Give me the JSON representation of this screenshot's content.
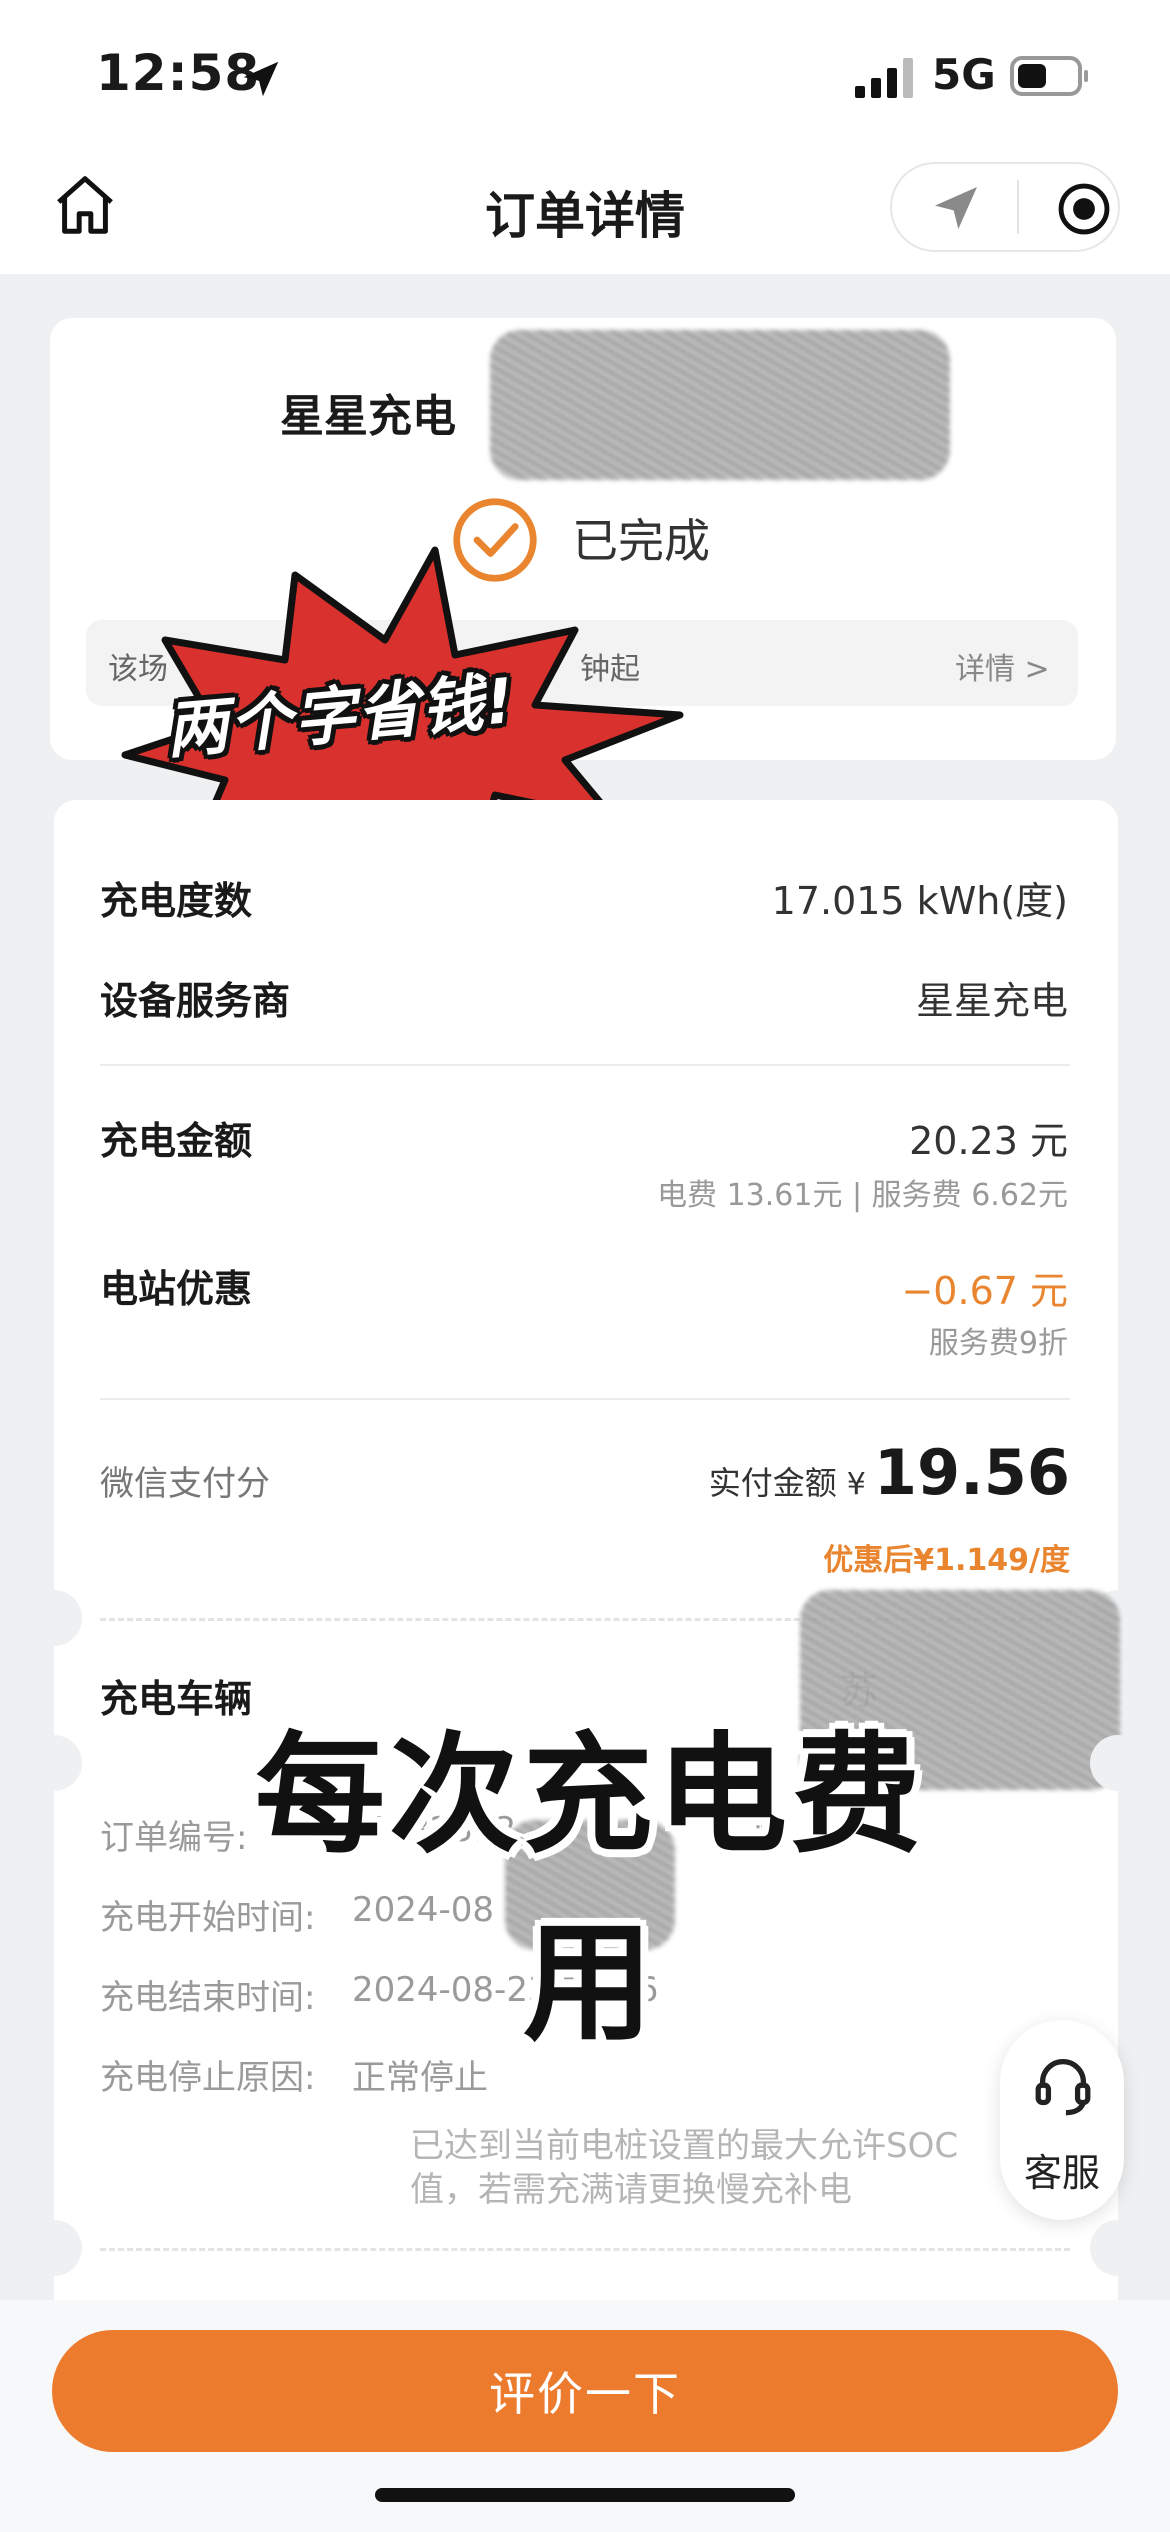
{
  "status_bar": {
    "time": "12:58",
    "network": "5G",
    "icons": [
      "location-arrow-icon",
      "signal-icon",
      "battery-icon"
    ]
  },
  "nav": {
    "title": "订单详情",
    "home_icon": "home-icon",
    "capsule_left_icon": "location-icon",
    "capsule_right_icon": "record-icon"
  },
  "order": {
    "station_name": "星星充电",
    "status": "已完成",
    "info_prefix": "该场",
    "info_suffix": "钟起",
    "info_link": "详情 >"
  },
  "overlay": {
    "burst_text": "两个字省钱!",
    "caption": "每次充电费用"
  },
  "details": {
    "energy_label": "充电度数",
    "energy_value": "17.015 kWh(度)",
    "provider_label": "设备服务商",
    "provider_value": "星星充电",
    "amount_label": "充电金额",
    "amount_value": "20.23 元",
    "amount_breakdown": "电费 13.61元 | 服务费 6.62元",
    "discount_label": "电站优惠",
    "discount_value": "−0.67 元",
    "discount_note": "服务费9折",
    "pay_method": "微信支付分",
    "pay_label": "实付金额",
    "pay_currency": "¥",
    "pay_amount": "19.56",
    "pay_unit_price": "优惠后¥1.149/度"
  },
  "vehicle": {
    "label": "充电车辆",
    "plate_prefix": "苏"
  },
  "meta": {
    "order_no_label": "订单编号:",
    "order_no_value": "2024082312",
    "start_label": "充电开始时间:",
    "start_value": "2024-08",
    "end_label": "充电结束时间:",
    "end_value": "2024-08-23 12:46",
    "stop_label": "充电停止原因:",
    "stop_value": "正常停止",
    "stop_note_line1": "已达到当前电桩设置的最大允许SOC",
    "stop_note_line2": "值，若需充满请更换慢充补电"
  },
  "service": {
    "label": "客服",
    "icon": "headset-icon"
  },
  "bottom": {
    "button_label": "评价一下"
  },
  "colors": {
    "accent": "#ec7b2d",
    "discount": "#e9852f",
    "burst": "#d9312d"
  }
}
